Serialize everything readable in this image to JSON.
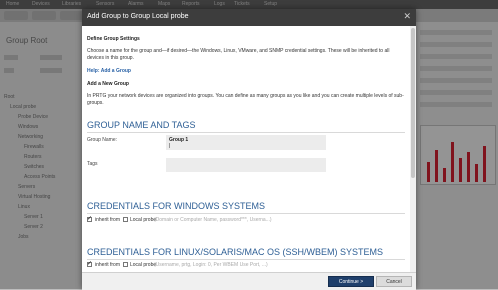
{
  "background": {
    "top_menu": [
      "Home",
      "Devices",
      "Libraries",
      "Sensors",
      "Alarms",
      "Maps",
      "Reports",
      "Logs",
      "Tickets",
      "Setup"
    ],
    "page_title": "Group Root",
    "tree": [
      "Root",
      "Local probe",
      "Probe Device",
      "Windows",
      "Networking",
      "Firewalls",
      "Routers",
      "Switches",
      "Access Points",
      "Servers",
      "Virtual Hosting",
      "Linux",
      "Server 1",
      "Server 2",
      "Jobs"
    ]
  },
  "dialog": {
    "title": "Add Group to Group Local probe",
    "close_glyph": "✕",
    "settings_heading": "Define Group Settings",
    "intro_text": "Choose a name for the group and—if desired—the Windows, Linux, VMware, and SNMP credential settings. These will be inherited to all devices in this group.",
    "help_link": "Help: Add a Group",
    "add_group_heading": "Add a New Group",
    "add_group_text": "In PRTG your network devices are organized into groups. You can define as many groups as you like and you can create multiple levels of sub-groups.",
    "section_name_tags": "GROUP NAME AND TAGS",
    "group_name_label": "Group Name:",
    "group_name_value": "Group 1",
    "tags_label": "Tags",
    "section_windows": "CREDENTIALS FOR WINDOWS SYSTEMS",
    "inherit_label": "inherit from",
    "local_probe_label": "Local probe",
    "windows_placeholder": "(Domain or Computer Name, password***, Userna...)",
    "section_linux": "CREDENTIALS FOR LINUX/SOLARIS/MAC OS (SSH/WBEM) SYSTEMS",
    "linux_placeholder": "(Username, prtg, Login: 0, Per WBEM Use Port, ...)",
    "continue_button": "Continue >",
    "cancel_button": "Cancel"
  },
  "colors": {
    "header_bg": "#3d3d3d",
    "section_heading": "#2e5f95",
    "link": "#2a62a6",
    "primary_button": "#1f3f6b"
  }
}
